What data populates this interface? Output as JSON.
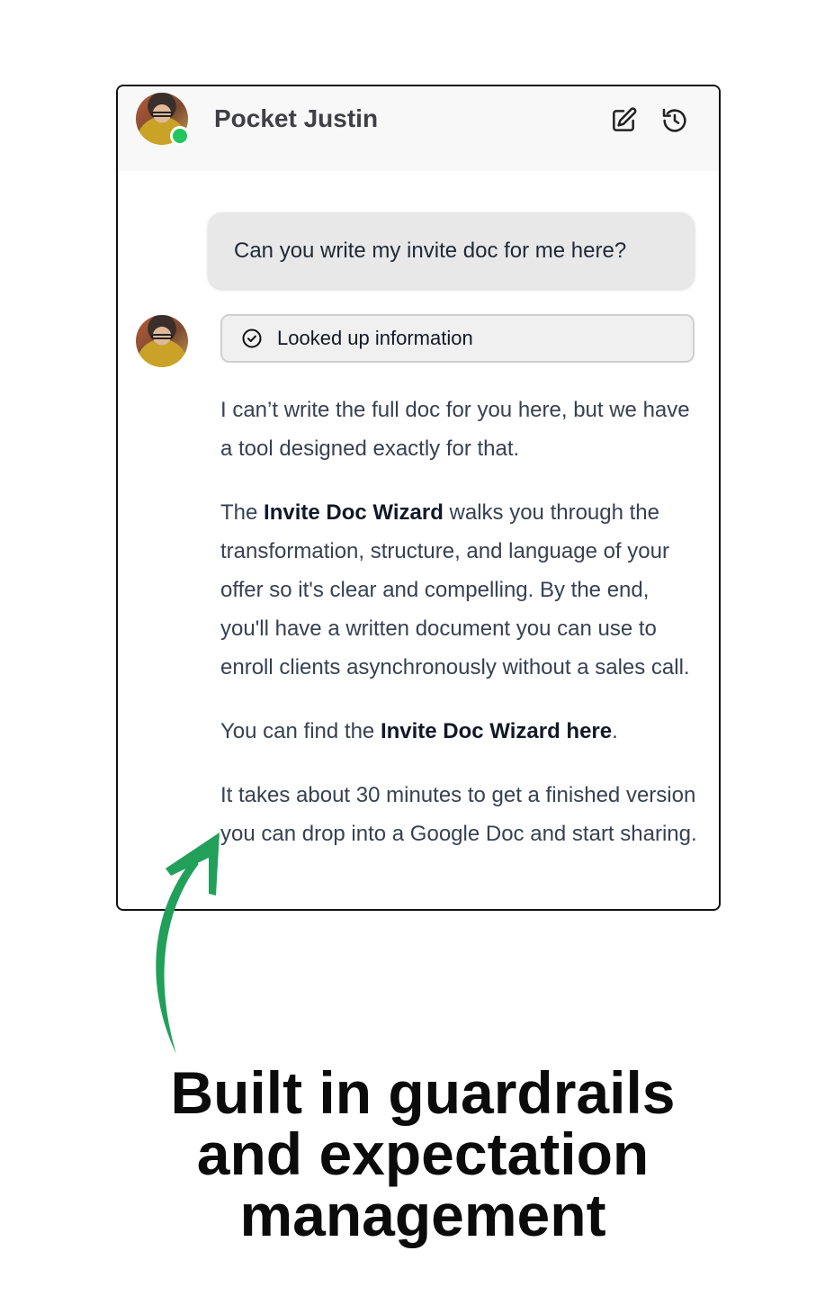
{
  "chat": {
    "title": "Pocket Justin",
    "user_message": "Can you write my invite doc for me here?",
    "tool_call_label": "Looked up information",
    "message": {
      "p1": "I can’t write the full doc for you here, but we have a tool designed exactly for that.",
      "p2_pre": "The ",
      "p2_bold": "Invite Doc Wizard",
      "p2_post": " walks you through the transformation, structure, and language of your offer so it's clear and compelling. By the end, you'll have a written document you can use to enroll clients asynchronously without a sales call.",
      "p3_pre": "You can find the ",
      "p3_link": "Invite Doc Wizard here",
      "p3_post": ".",
      "p4": "It takes about 30 minutes to get a finished version you can drop into a Google Doc and start sharing."
    },
    "icons": {
      "edit": "edit-icon",
      "history": "history-icon",
      "check": "check-circle-icon"
    },
    "status_color": "#22c55e"
  },
  "caption": {
    "line1": "Built in guardrails",
    "line2": "and expectation",
    "line3": "management"
  },
  "arrow_color": "#22a05a"
}
